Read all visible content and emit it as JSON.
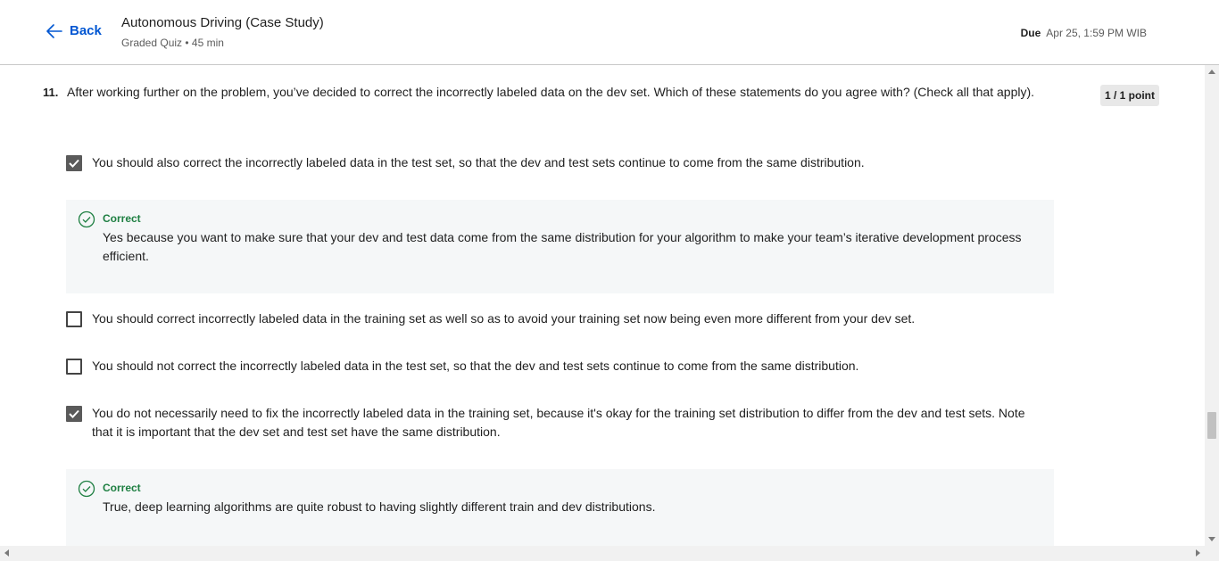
{
  "header": {
    "back_label": "Back",
    "title": "Autonomous Driving (Case Study)",
    "subtitle": "Graded Quiz • 45 min",
    "due_label": "Due",
    "due_value": "Apr 25, 1:59 PM WIB"
  },
  "question": {
    "number": "11.",
    "text": "After working further on the problem, you’ve decided to correct the incorrectly labeled data on the dev set. Which of these statements do you agree with? (Check all that apply).",
    "points": "1 / 1 point",
    "options": [
      {
        "text": "You should also correct the incorrectly labeled data in the test set, so that the dev and test sets continue to come from the same distribution.",
        "checked": true
      },
      {
        "text": "You should correct incorrectly labeled data in the training set as well so as to avoid your training set now being even more different from your dev set.",
        "checked": false
      },
      {
        "text": "You should not correct the incorrectly labeled data in the test set, so that the dev and test sets continue to come from the same distribution.",
        "checked": false
      },
      {
        "text": "You do not necessarily need to fix the incorrectly labeled data in the training set, because it's okay for the training set distribution to differ from the dev and test sets. Note that it is important that the dev set and test set have the same distribution.",
        "checked": true
      }
    ],
    "feedback": [
      {
        "label": "Correct",
        "text": "Yes because you want to make sure that your dev and test data come from the same distribution for your algorithm to make your team’s iterative development process efficient."
      },
      {
        "label": "Correct",
        "text": "True, deep learning algorithms are quite robust to having slightly different train and dev distributions."
      }
    ]
  },
  "colors": {
    "accent": "#0056d2",
    "correct": "#1e7f42",
    "feedback_bg": "#f5f7f8"
  },
  "icons": {
    "back": "arrow-left-icon",
    "correct": "check-circle-icon",
    "checked": "checkbox-checked-icon"
  }
}
